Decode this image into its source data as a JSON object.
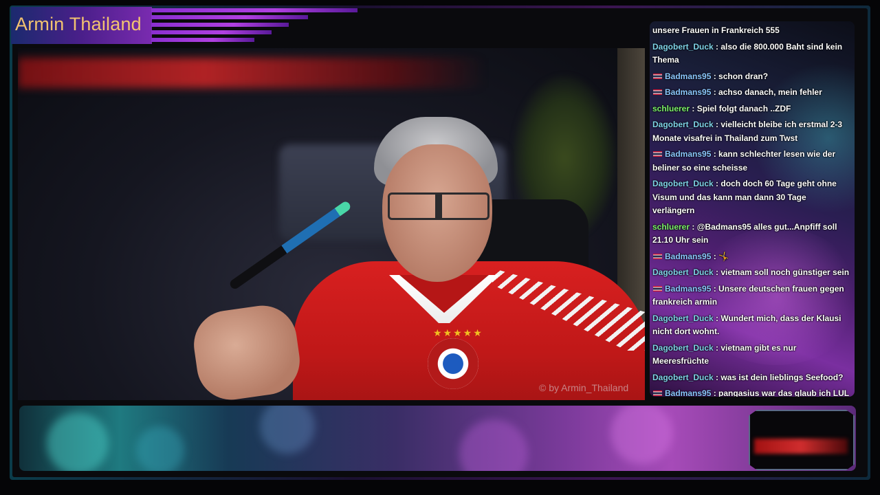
{
  "channel": {
    "title": "Armin Thailand",
    "watermark": "© by Armin_Thailand"
  },
  "colors": {
    "title_text": "#f2c270",
    "chat_user_cyan": "#7fd3e8",
    "chat_user_green": "#7cf26a",
    "chat_user_blue": "#8cc8ff"
  },
  "chat": {
    "messages": [
      {
        "user": "",
        "flag": false,
        "color": "",
        "text": "unsere Frauen in Frankreich 555"
      },
      {
        "user": "Dagobert_Duck",
        "flag": false,
        "color": "#7fd3e8",
        "text": ": also die 800.000 Baht sind kein Thema"
      },
      {
        "user": "Badmans95",
        "flag": true,
        "color": "#8cc8ff",
        "text": ": schon dran?"
      },
      {
        "user": "Badmans95",
        "flag": true,
        "color": "#8cc8ff",
        "text": ": achso danach, mein fehler"
      },
      {
        "user": "schluerer",
        "flag": false,
        "color": "#7cf26a",
        "text": ": Spiel folgt danach ..ZDF"
      },
      {
        "user": "Dagobert_Duck",
        "flag": false,
        "color": "#7fd3e8",
        "text": ": vielleicht bleibe ich erstmal 2-3 Monate visafrei in Thailand zum Twst"
      },
      {
        "user": "Badmans95",
        "flag": true,
        "color": "#8cc8ff",
        "text": ": kann schlechter lesen wie der beliner so eine scheisse"
      },
      {
        "user": "Dagobert_Duck",
        "flag": false,
        "color": "#7fd3e8",
        "text": ": doch doch 60 Tage geht ohne Visum und das kann man dann 30 Tage verlängern"
      },
      {
        "user": "schluerer",
        "flag": false,
        "color": "#7cf26a",
        "text": ": @Badmans95 alles gut...Anpfiff soll 21.10 Uhr sein"
      },
      {
        "user": "Badmans95",
        "flag": true,
        "color": "#8cc8ff",
        "text": ": 🤸"
      },
      {
        "user": "Dagobert_Duck",
        "flag": false,
        "color": "#7fd3e8",
        "text": ": vietnam soll noch günstiger sein"
      },
      {
        "user": "Badmans95",
        "flag": true,
        "color": "#8cc8ff",
        "text": ": Unsere deutschen frauen gegen frankreich armin"
      },
      {
        "user": "Dagobert_Duck",
        "flag": false,
        "color": "#7fd3e8",
        "text": ": Wundert mich, dass der Klausi nicht dort wohnt."
      },
      {
        "user": "Dagobert_Duck",
        "flag": false,
        "color": "#7fd3e8",
        "text": ": vietnam gibt es nur Meeresfrüchte"
      },
      {
        "user": "Dagobert_Duck",
        "flag": false,
        "color": "#7fd3e8",
        "text": ": was ist dein lieblings Seefood?"
      },
      {
        "user": "Badmans95",
        "flag": true,
        "color": "#8cc8ff",
        "text": ": pangasius war das glaub ich LUL ach ne das war der suffi aus ban chang"
      }
    ]
  }
}
